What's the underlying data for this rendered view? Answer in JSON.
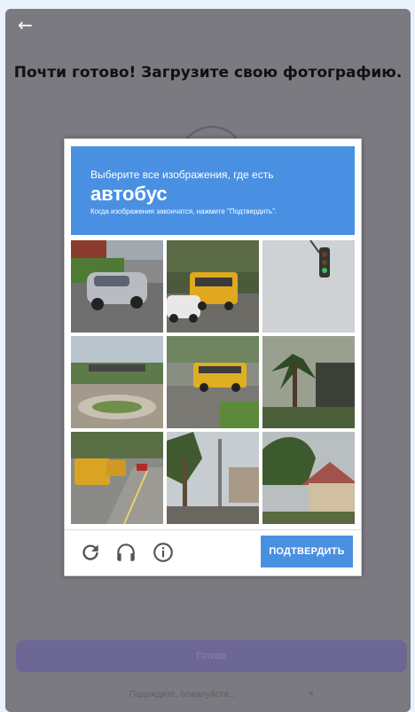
{
  "page": {
    "title": "Почти готово! Загрузите свою фотографию.",
    "done_label": "Готово",
    "wait_text": "Подождите, пожалуйста..."
  },
  "captcha": {
    "instruction": "Выберите все изображения, где есть",
    "target_word": "автобус",
    "note": "Когда изображения закончатся, нажмите \"Подтвердить\".",
    "verify_label": "ПОДТВЕРДИТЬ",
    "tiles": [
      {
        "scene": "street-with-silver-car"
      },
      {
        "scene": "yellow-school-bus-and-white-car"
      },
      {
        "scene": "traffic-light"
      },
      {
        "scene": "roundabout-with-sign"
      },
      {
        "scene": "yellow-school-bus-on-road"
      },
      {
        "scene": "palm-tree-and-house"
      },
      {
        "scene": "school-buses-on-street"
      },
      {
        "scene": "palm-trees-by-road"
      },
      {
        "scene": "trees-and-house"
      }
    ],
    "footer_icons": [
      "reload-icon",
      "headphones-icon",
      "info-icon"
    ]
  },
  "colors": {
    "accent": "#4a90e2",
    "overlay": "#7a7a80",
    "done_button": "#6d6796"
  }
}
